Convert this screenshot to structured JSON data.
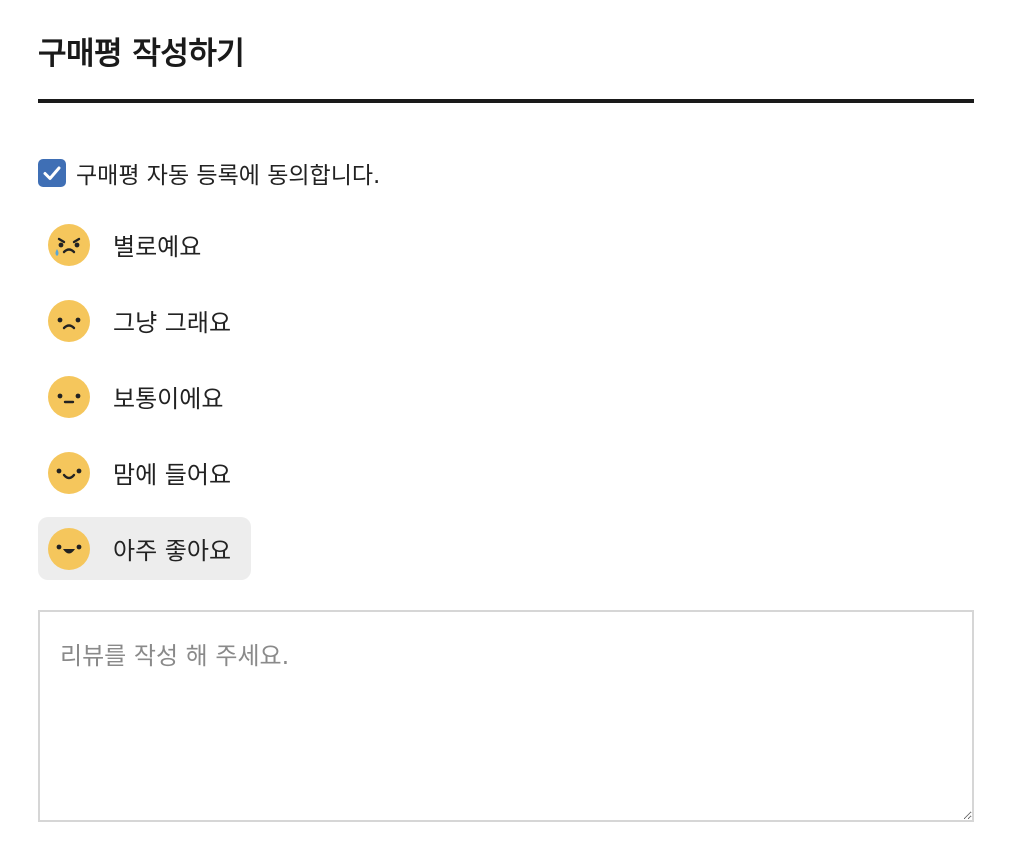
{
  "page": {
    "title": "구매평 작성하기"
  },
  "agreement": {
    "label": "구매평 자동 등록에 동의합니다.",
    "checked": true
  },
  "ratings": [
    {
      "label": "별로예요",
      "icon": "crying-face-icon",
      "selected": false
    },
    {
      "label": "그냥 그래요",
      "icon": "sad-face-icon",
      "selected": false
    },
    {
      "label": "보통이에요",
      "icon": "neutral-face-icon",
      "selected": false
    },
    {
      "label": "맘에 들어요",
      "icon": "smiling-face-icon",
      "selected": false
    },
    {
      "label": "아주 좋아요",
      "icon": "happy-face-icon",
      "selected": true
    }
  ],
  "review": {
    "placeholder": "리뷰를 작성 해 주세요.",
    "value": ""
  },
  "colors": {
    "accent": "#3f6fb5",
    "emoji_face": "#f5c65c",
    "selected_bg": "#ededed",
    "rule": "#1a1a1a"
  }
}
